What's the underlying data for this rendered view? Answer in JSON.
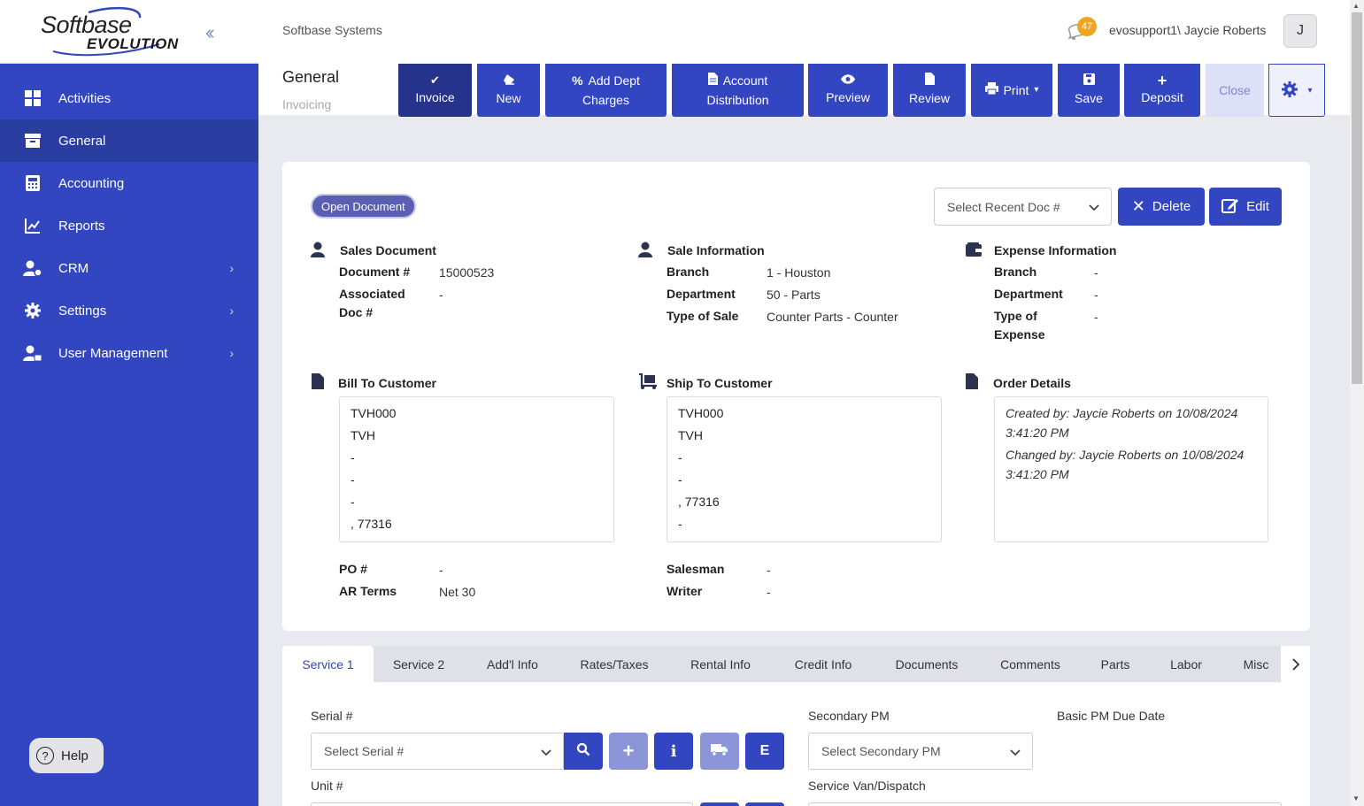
{
  "app": {
    "logo_top": "Softbase",
    "logo_bottom": "EVOLUTION",
    "company": "Softbase Systems",
    "notification_count": "47",
    "user": "evosupport1\\ Jaycie Roberts",
    "avatar_initial": "J"
  },
  "sidebar": {
    "items": [
      {
        "label": "Activities"
      },
      {
        "label": "General"
      },
      {
        "label": "Accounting"
      },
      {
        "label": "Reports"
      },
      {
        "label": "CRM"
      },
      {
        "label": "Settings"
      },
      {
        "label": "User Management"
      }
    ],
    "help": "Help"
  },
  "page": {
    "title": "General",
    "subtitle": "Invoicing"
  },
  "toolbar": {
    "invoice": "Invoice",
    "new": "New",
    "add_dept_1": "Add Dept",
    "add_dept_2": "Charges",
    "acct_1": "Account",
    "acct_2": "Distribution",
    "preview": "Preview",
    "review": "Review",
    "print": "Print",
    "save": "Save",
    "deposit": "Deposit",
    "close": "Close"
  },
  "doc": {
    "status": "Open Document",
    "recent_placeholder": "Select Recent Doc #",
    "delete": "Delete",
    "edit": "Edit"
  },
  "sales_document": {
    "title": "Sales Document",
    "doc_label": "Document #",
    "doc_value": "15000523",
    "assoc_label_1": "Associated",
    "assoc_label_2": "Doc #",
    "assoc_value": "-"
  },
  "sale_info": {
    "title": "Sale Information",
    "branch_label": "Branch",
    "branch_value": "1 - Houston",
    "dept_label": "Department",
    "dept_value": "50 - Parts",
    "type_label": "Type of Sale",
    "type_value": "Counter Parts - Counter"
  },
  "expense_info": {
    "title": "Expense Information",
    "branch_label": "Branch",
    "branch_value": "-",
    "dept_label": "Department",
    "dept_value": "-",
    "type_label_1": "Type of",
    "type_label_2": "Expense",
    "type_value": "-"
  },
  "bill_to": {
    "title": "Bill To Customer",
    "lines": [
      "TVH000",
      "TVH",
      "-",
      "-",
      "-",
      ", 77316"
    ],
    "po_label": "PO #",
    "po_value": "-",
    "ar_label": "AR Terms",
    "ar_value": "Net 30"
  },
  "ship_to": {
    "title": "Ship To Customer",
    "lines": [
      "TVH000",
      "TVH",
      "-",
      "-",
      ", 77316",
      "-"
    ],
    "salesman_label": "Salesman",
    "salesman_value": "-",
    "writer_label": "Writer",
    "writer_value": "-"
  },
  "order_details": {
    "title": "Order Details",
    "created_1": "Created by: Jaycie Roberts on 10/08/2024",
    "created_2": "3:41:20 PM",
    "changed_1": "Changed by: Jaycie Roberts on 10/08/2024",
    "changed_2": "3:41:20 PM"
  },
  "tabs": [
    "Service 1",
    "Service 2",
    "Add'l Info",
    "Rates/Taxes",
    "Rental Info",
    "Credit Info",
    "Documents",
    "Comments",
    "Parts",
    "Labor",
    "Misc"
  ],
  "service": {
    "serial_label": "Serial #",
    "serial_placeholder": "Select Serial #",
    "secondary_pm_label": "Secondary PM",
    "secondary_pm_placeholder": "Select Secondary PM",
    "basic_pm_label": "Basic PM Due Date",
    "unit_label": "Unit #",
    "van_label": "Service Van/Dispatch",
    "e_button": "E"
  },
  "colors": {
    "primary": "#3346c1",
    "primary_dark": "#26338a",
    "badge": "#f1a420"
  }
}
